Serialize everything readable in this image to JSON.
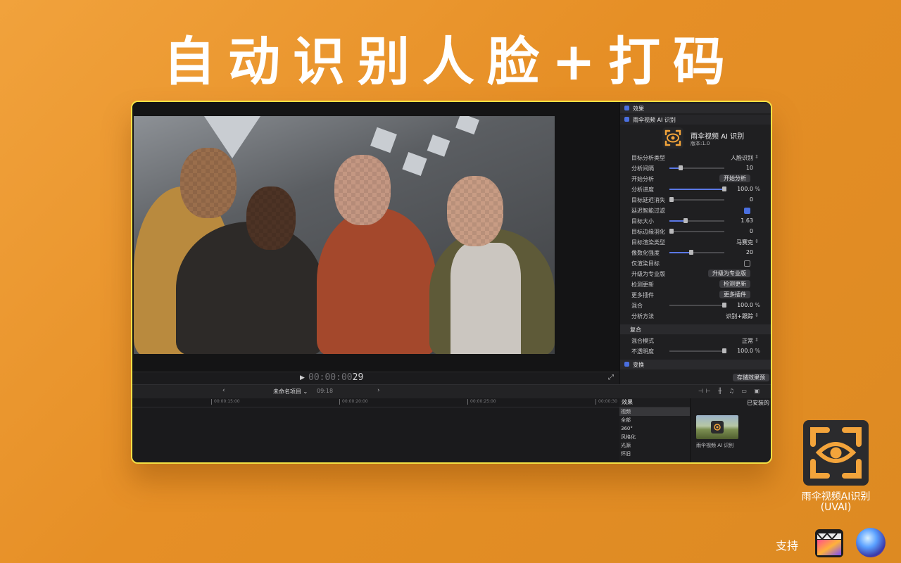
{
  "headline": "自动识别人脸+打码",
  "viewer": {
    "timecode_dim": "00:00:00",
    "timecode_frame": "29"
  },
  "inspector": {
    "effects_header": "效果",
    "plugin_header": "雨伞视频 AI 识别",
    "plugin_title": "雨伞视频 AI 识别",
    "plugin_version": "版本:1.0",
    "params": [
      {
        "label": "目标分析类型",
        "value": "人脸识别"
      },
      {
        "label": "分析间隔",
        "value": "10",
        "fraction": 0.2
      },
      {
        "label": "开始分析",
        "button": "开始分析"
      },
      {
        "label": "分析进度",
        "value": "100.0",
        "unit": "%",
        "fraction": 1.0
      },
      {
        "label": "目标延迟消失",
        "value": "0",
        "fraction": 0.0
      },
      {
        "label": "延迟智能过滤",
        "checked": true
      },
      {
        "label": "目标大小",
        "value": "1.63",
        "fraction": 0.3
      },
      {
        "label": "目标边缘羽化",
        "value": "0",
        "fraction": 0.0
      },
      {
        "label": "目标渲染类型",
        "value": "马赛克"
      },
      {
        "label": "像数化强度",
        "value": "20",
        "fraction": 0.4
      },
      {
        "label": "仅渲染目标",
        "checked": false
      },
      {
        "label": "升级为专业版",
        "button": "升级为专业版"
      },
      {
        "label": "检测更新",
        "button": "检测更新"
      },
      {
        "label": "更多插件",
        "button": "更多插件"
      },
      {
        "label": "混合",
        "value": "100.0",
        "unit": "%",
        "fraction": 1.0
      },
      {
        "label": "分析方法",
        "value": "识别+跟踪"
      }
    ],
    "composite_header": "复合",
    "blend_mode_label": "混合模式",
    "blend_mode_value": "正常",
    "opacity_label": "不透明度",
    "opacity_value": "100.0",
    "opacity_unit": "%",
    "opacity_fraction": 1.0,
    "transform_header": "变换",
    "save_button": "存储效果预"
  },
  "timeline": {
    "project_name": "未命名项目",
    "duration": "09:18",
    "ruler": [
      "00:00:15:00",
      "00:00:20:00",
      "00:00:25:00",
      "00:00:30"
    ]
  },
  "effects_browser": {
    "header": "效果",
    "installed_header": "已安装的",
    "categories": [
      "视频",
      "全部",
      "360°",
      "风格化",
      "光源",
      "怀旧"
    ],
    "selected": "视频",
    "thumb_label": "雨伞视频 AI 识别"
  },
  "badge": {
    "name_line1": "雨伞视频AI识别",
    "name_line2": "(UVAI)",
    "support": "支持"
  },
  "colors": {
    "background": "#e8952c",
    "frame_border": "#f4e044",
    "accent_blue": "#4a6fe0",
    "icon_orange": "#f3a43b"
  }
}
